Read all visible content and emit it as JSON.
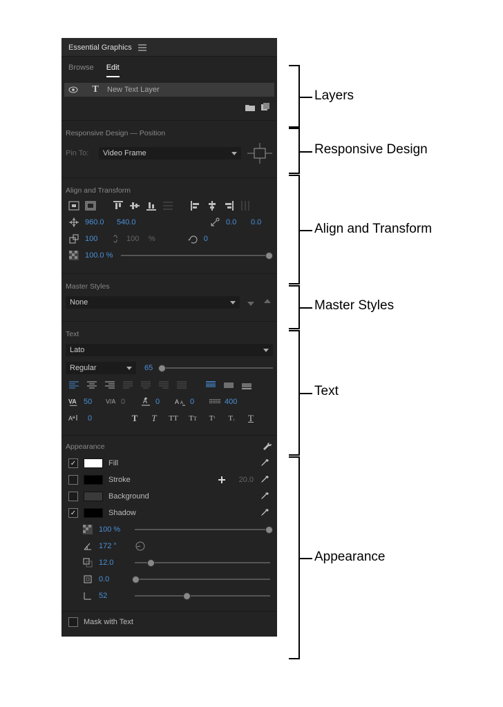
{
  "panel": {
    "title": "Essential Graphics"
  },
  "tabs": {
    "browse": "Browse",
    "edit": "Edit"
  },
  "layer": {
    "name": "New Text Layer"
  },
  "responsive": {
    "title": "Responsive Design — Position",
    "pinToLabel": "Pin To:",
    "pinToValue": "Video Frame"
  },
  "alignTransform": {
    "title": "Align and Transform",
    "posX": "960.0",
    "posY": "540.0",
    "anchorX": "0.0",
    "anchorY": "0.0",
    "scale": "100",
    "scaleLocked": "100",
    "pct1": "%",
    "rotation": "0",
    "opacity": "100.0 %"
  },
  "master": {
    "title": "Master Styles",
    "value": "None"
  },
  "text": {
    "title": "Text",
    "font": "Lato",
    "weight": "Regular",
    "size": "65",
    "tracking": "50",
    "kerning": "0",
    "leading": "0",
    "tsume": "0",
    "lineWidth": "400",
    "baseline": "0"
  },
  "appearance": {
    "title": "Appearance",
    "fill": {
      "label": "Fill",
      "checked": true,
      "color": "#ffffff"
    },
    "stroke": {
      "label": "Stroke",
      "checked": false,
      "color": "#000000",
      "width": "20.0"
    },
    "background": {
      "label": "Background",
      "checked": false,
      "color": "#3a3a3a"
    },
    "shadow": {
      "label": "Shadow",
      "checked": true,
      "color": "#000000",
      "opacity": "100 %",
      "angle": "172 °",
      "distance": "12.0",
      "size": "0.0",
      "blur": "52"
    },
    "maskWithText": "Mask with Text"
  },
  "callouts": {
    "layers": "Layers",
    "responsive": "Responsive Design",
    "align": "Align and Transform",
    "master": "Master Styles",
    "text": "Text",
    "appearance": "Appearance"
  }
}
